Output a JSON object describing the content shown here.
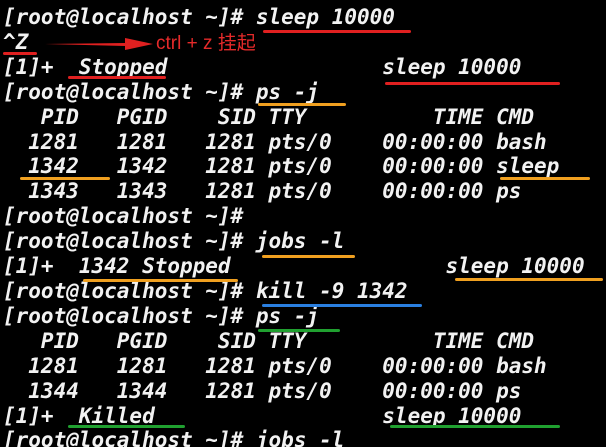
{
  "terminal": {
    "lines": [
      "[root@localhost ~]# sleep 10000",
      "^Z",
      "[1]+  Stopped                 sleep 10000",
      "[root@localhost ~]# ps -j",
      "   PID   PGID    SID TTY          TIME CMD",
      "  1281   1281   1281 pts/0    00:00:00 bash",
      "  1342   1342   1281 pts/0    00:00:00 sleep",
      "  1343   1343   1281 pts/0    00:00:00 ps",
      "[root@localhost ~]#",
      "[root@localhost ~]# jobs -l",
      "[1]+  1342 Stopped                 sleep 10000",
      "[root@localhost ~]# kill -9 1342",
      "[root@localhost ~]# ps -j",
      "   PID   PGID    SID TTY          TIME CMD",
      "  1281   1281   1281 pts/0    00:00:00 bash",
      "  1344   1344   1281 pts/0    00:00:00 ps",
      "[1]+  Killed                  sleep 10000",
      "[root@localhost ~]# jobs -l"
    ]
  },
  "annotation": {
    "note": "ctrl + z 挂起",
    "colors": {
      "red": "#e02020",
      "orange": "#f0a020",
      "blue": "#2a7fe0",
      "green": "#20a030"
    }
  }
}
